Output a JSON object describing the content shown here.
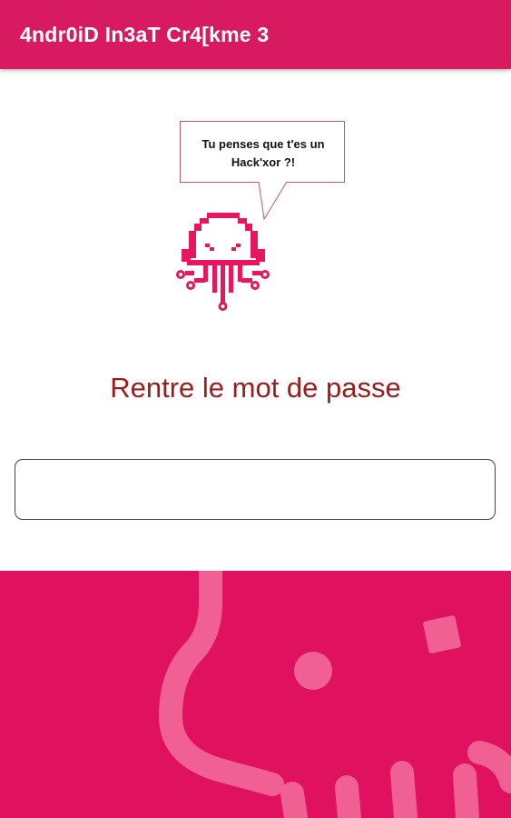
{
  "app_bar": {
    "title": "4ndr0iD In3aT Cr4[kme 3"
  },
  "speech_bubble": {
    "text": "Tu penses que t'es un\nHack'xor ?!"
  },
  "mascot": {
    "icon": "pixel-octopus-icon",
    "color": "#e8155f"
  },
  "prompt": {
    "label": "Rentre le mot de passe"
  },
  "password_input": {
    "value": "",
    "placeholder": ""
  },
  "colors": {
    "app_bar": "#d81b60",
    "prompt_text": "#9e1b1b",
    "footer": "#e0115f",
    "footer_decoration": "#f06092"
  }
}
